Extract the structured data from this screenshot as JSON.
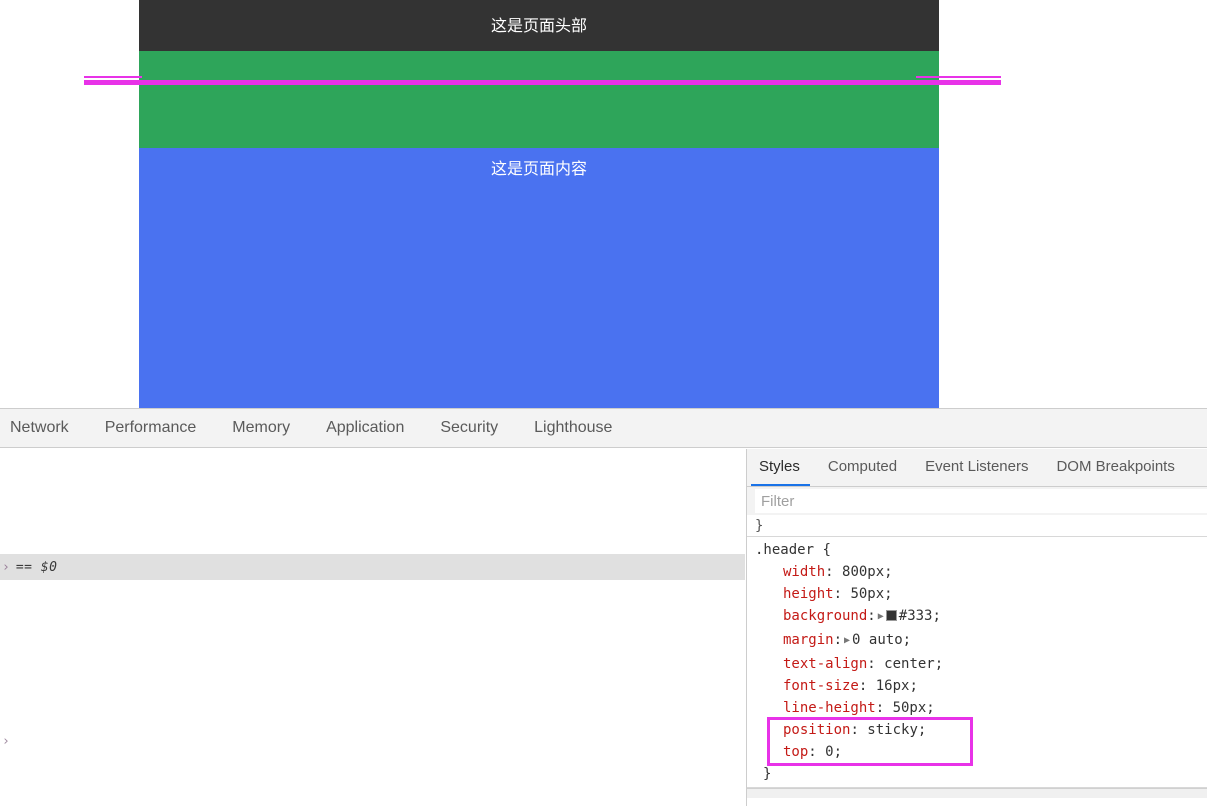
{
  "preview": {
    "header_text": "这是页面头部",
    "content_text": "这是页面内容",
    "colors": {
      "header_bg": "#333333",
      "nav_bg": "#2ea55a",
      "content_bg": "#4a72f0",
      "ruler": "#e832e8"
    }
  },
  "devtools": {
    "main_tabs": [
      {
        "label": "Network"
      },
      {
        "label": "Performance"
      },
      {
        "label": "Memory"
      },
      {
        "label": "Application"
      },
      {
        "label": "Security"
      },
      {
        "label": "Lighthouse"
      }
    ],
    "console": {
      "selected_node_caret": "›",
      "selected_node_expr": "== $0",
      "prompt_caret": "›"
    },
    "sidebar": {
      "tabs": [
        {
          "label": "Styles",
          "selected": true
        },
        {
          "label": "Computed",
          "selected": false
        },
        {
          "label": "Event Listeners",
          "selected": false
        },
        {
          "label": "DOM Breakpoints",
          "selected": false
        }
      ],
      "filter_placeholder": "Filter",
      "filter_value": "",
      "partial_rule_above": "}",
      "rule": {
        "selector": ".header",
        "open_brace": "{",
        "close_brace": "}",
        "declarations": [
          {
            "prop": "width",
            "value": "800px",
            "expandable": false,
            "swatch": false
          },
          {
            "prop": "height",
            "value": "50px",
            "expandable": false,
            "swatch": false
          },
          {
            "prop": "background",
            "value": "#333",
            "expandable": true,
            "swatch": true,
            "swatch_color": "#333333"
          },
          {
            "prop": "margin",
            "value": "0 auto",
            "expandable": true,
            "swatch": false
          },
          {
            "prop": "text-align",
            "value": "center",
            "expandable": false,
            "swatch": false
          },
          {
            "prop": "font-size",
            "value": "16px",
            "expandable": false,
            "swatch": false
          },
          {
            "prop": "line-height",
            "value": "50px",
            "expandable": false,
            "swatch": false
          },
          {
            "prop": "position",
            "value": "sticky",
            "expandable": false,
            "swatch": false,
            "highlighted": true
          },
          {
            "prop": "top",
            "value": "0",
            "expandable": false,
            "swatch": false,
            "highlighted": true
          }
        ]
      }
    }
  }
}
